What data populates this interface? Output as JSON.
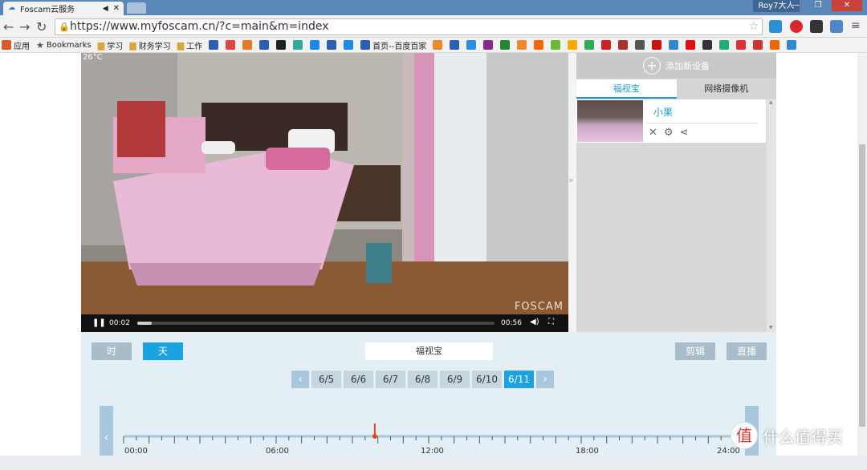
{
  "browser": {
    "tab_title": "Foscam云服务",
    "user": "Roy7大人",
    "url": "https://www.myfoscam.cn/?c=main&m=index"
  },
  "bookmarks": {
    "apps": "应用",
    "items": [
      "Bookmarks",
      "学习",
      "财务学习",
      "工作",
      "首页--百度百家"
    ]
  },
  "device_panel": {
    "add_label": "添加新设备",
    "tabs": [
      "福视宝",
      "网络摄像机"
    ],
    "device_name": "小果"
  },
  "video": {
    "temperature": "26°C",
    "watermark": "FOSCAM",
    "current_time": "00:02",
    "duration": "00:56",
    "progress": 0.04
  },
  "controls": {
    "hour_button": "时",
    "day_button": "天",
    "source_label": "福视宝",
    "clip_button": "剪辑",
    "live_button": "直播"
  },
  "dates": {
    "prev": "‹",
    "next": "›",
    "items": [
      "6/5",
      "6/6",
      "6/7",
      "6/8",
      "6/9",
      "6/10",
      "6/11"
    ],
    "selected": "6/11"
  },
  "timeline": {
    "labels": [
      "00:00",
      "06:00",
      "12:00",
      "18:00",
      "24:00"
    ],
    "current_hour": 9.88
  },
  "watermark_site": {
    "glyph": "值",
    "text": "什么值得买"
  }
}
